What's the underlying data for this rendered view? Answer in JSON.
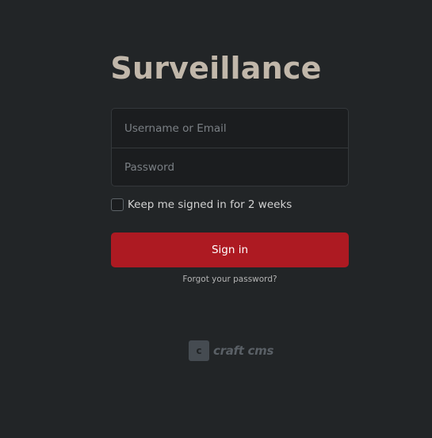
{
  "site_title": "Surveillance",
  "login": {
    "username_placeholder": "Username or Email",
    "password_placeholder": "Password",
    "remember_label": "Keep me signed in for 2 weeks",
    "remember_checked": false,
    "signin_label": "Sign in",
    "forgot_link": "Forgot your password?"
  },
  "branding": {
    "icon": "craft-logo-icon",
    "mark_letter": "c",
    "text": "craft cms"
  },
  "colors": {
    "background": "#222527",
    "title": "#c1b7aa",
    "accent": "#ad1a22"
  }
}
